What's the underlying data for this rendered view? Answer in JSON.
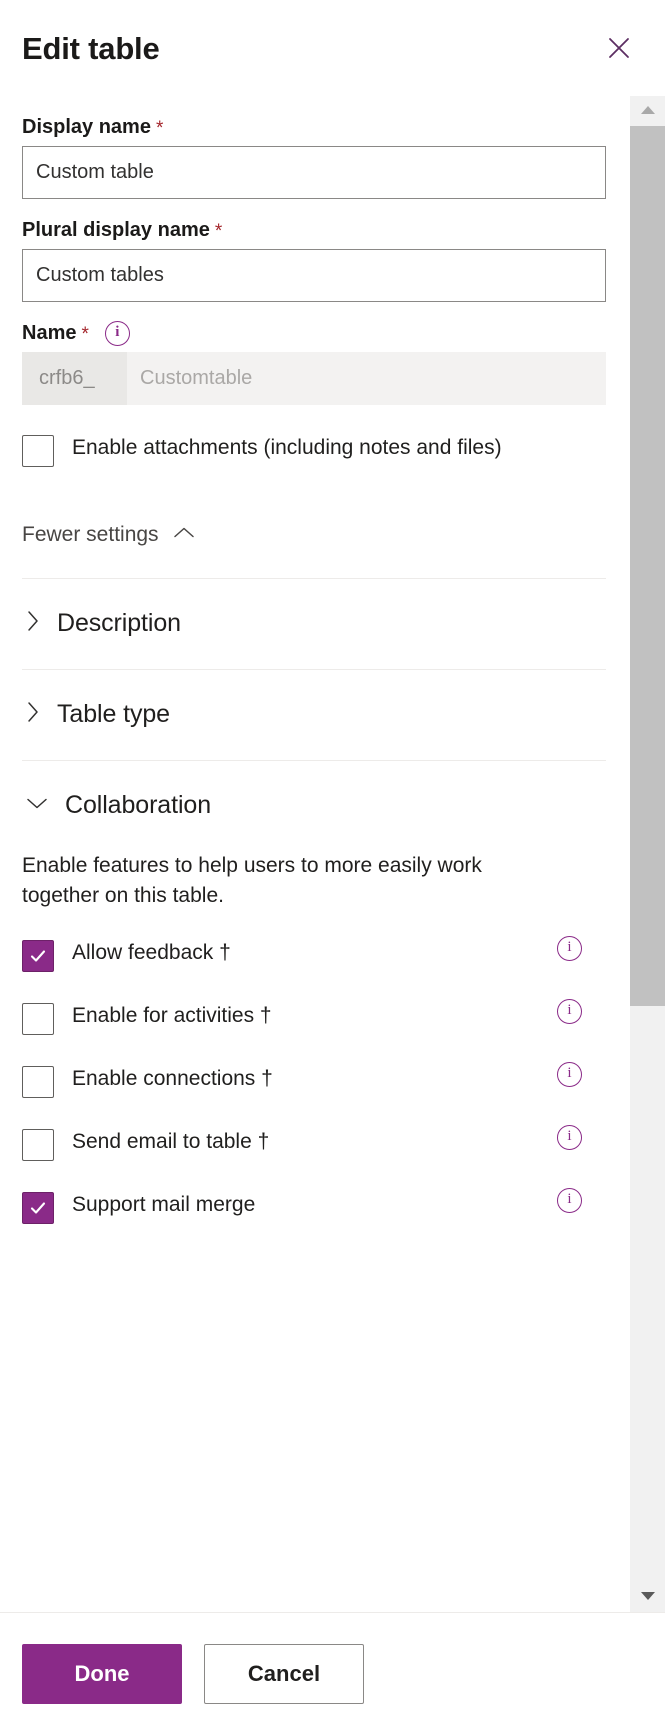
{
  "header": {
    "title": "Edit table",
    "close_icon": "close-icon"
  },
  "fields": {
    "display_name": {
      "label": "Display name",
      "required_marker": "*",
      "value": "Custom table",
      "placeholder": ""
    },
    "plural_display_name": {
      "label": "Plural display name",
      "required_marker": "*",
      "value": "Custom tables",
      "placeholder": ""
    },
    "name": {
      "label": "Name",
      "required_marker": "*",
      "info_icon": "info-icon",
      "prefix": "crfb6_",
      "value": "",
      "placeholder": "Customtable"
    }
  },
  "attachments": {
    "label": "Enable attachments (including notes and files)",
    "checked": false
  },
  "settings_toggle": {
    "label": "Fewer settings",
    "icon": "chevron-up-icon",
    "expanded": true
  },
  "sections": [
    {
      "label": "Description",
      "icon": "chevron-right-icon",
      "expanded": false
    },
    {
      "label": "Table type",
      "icon": "chevron-right-icon",
      "expanded": false
    },
    {
      "label": "Collaboration",
      "icon": "chevron-down-icon",
      "expanded": true
    }
  ],
  "collaboration": {
    "description": "Enable features to help users to more easily work together on this table.",
    "items": [
      {
        "label": "Allow feedback †",
        "checked": true,
        "info_icon": "info-icon"
      },
      {
        "label": "Enable for activities †",
        "checked": false,
        "info_icon": "info-icon"
      },
      {
        "label": "Enable connections †",
        "checked": false,
        "info_icon": "info-icon"
      },
      {
        "label": "Send email to table †",
        "checked": false,
        "info_icon": "info-icon"
      },
      {
        "label": "Support mail merge",
        "checked": true,
        "info_icon": "info-icon"
      }
    ]
  },
  "scrollbar": {
    "up_icon": "scroll-up-arrow-icon",
    "down_icon": "scroll-down-arrow-icon"
  },
  "footer": {
    "done_label": "Done",
    "cancel_label": "Cancel"
  },
  "colors": {
    "accent": "#8a2a88",
    "required": "#a4262c",
    "text": "#201f1e",
    "border": "#8a8886",
    "scroll_thumb": "#c1c1c1"
  }
}
